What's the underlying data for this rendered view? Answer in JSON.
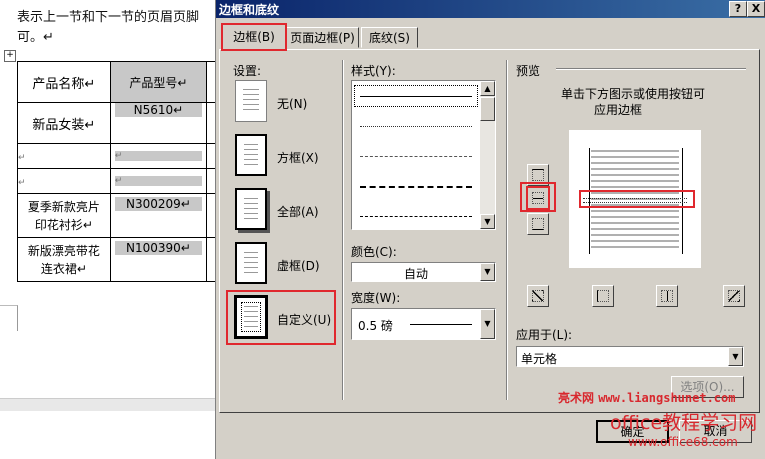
{
  "document": {
    "text_line1": "表示上一节和下一节的页眉页脚",
    "text_line2": "可。↵",
    "table": {
      "header": {
        "name": "产品名称↵",
        "model": "产品型号↵"
      },
      "rows": [
        {
          "name": "新品女装↵",
          "model": "N5610↵"
        },
        {
          "name": "↵",
          "model": "↵"
        },
        {
          "name": "↵",
          "model": "↵"
        },
        {
          "name": "夏季新款亮片印花衬衫↵",
          "model": "N300209↵"
        },
        {
          "name": "新版漂亮带花连衣裙↵",
          "model": "N100390↵"
        }
      ]
    }
  },
  "dialog": {
    "title": "边框和底纹",
    "title_buttons": {
      "help": "?",
      "close": "X"
    },
    "tabs": [
      {
        "label": "边框(B)",
        "active": true
      },
      {
        "label": "页面边框(P)",
        "active": false
      },
      {
        "label": "底纹(S)",
        "active": false
      }
    ],
    "settings": {
      "label": "设置:",
      "items": [
        {
          "label": "无(N)",
          "icon": "setting-none-icon"
        },
        {
          "label": "方框(X)",
          "icon": "setting-box-icon"
        },
        {
          "label": "全部(A)",
          "icon": "setting-all-icon"
        },
        {
          "label": "虚框(D)",
          "icon": "setting-grid-icon"
        },
        {
          "label": "自定义(U)",
          "icon": "setting-custom-icon",
          "selected": true
        }
      ]
    },
    "style": {
      "label": "样式(Y):",
      "lines": [
        "solid",
        "dotted",
        "dashed-fine",
        "dashed",
        "dash-dot"
      ]
    },
    "color": {
      "label": "颜色(C):",
      "value": "自动"
    },
    "width": {
      "label": "宽度(W):",
      "value": "0.5 磅"
    },
    "preview": {
      "label": "预览",
      "hint_line1": "单击下方图示或使用按钮可",
      "hint_line2": "应用边框"
    },
    "apply_to": {
      "label": "应用于(L):",
      "value": "单元格"
    },
    "options_button": "选项(O)...",
    "ok_button": "确定",
    "cancel_button": "取消"
  },
  "watermark": {
    "site_cn": "亮术网",
    "site_url": "www.liangshunet.com",
    "brand": "office教程学习网",
    "brand_url": "www.office68.com"
  },
  "colors": {
    "highlight": "#e0282e",
    "titlebar": "#0a246a",
    "dialog_bg": "#d4d0c8",
    "watermark_red": "#d8282e"
  }
}
